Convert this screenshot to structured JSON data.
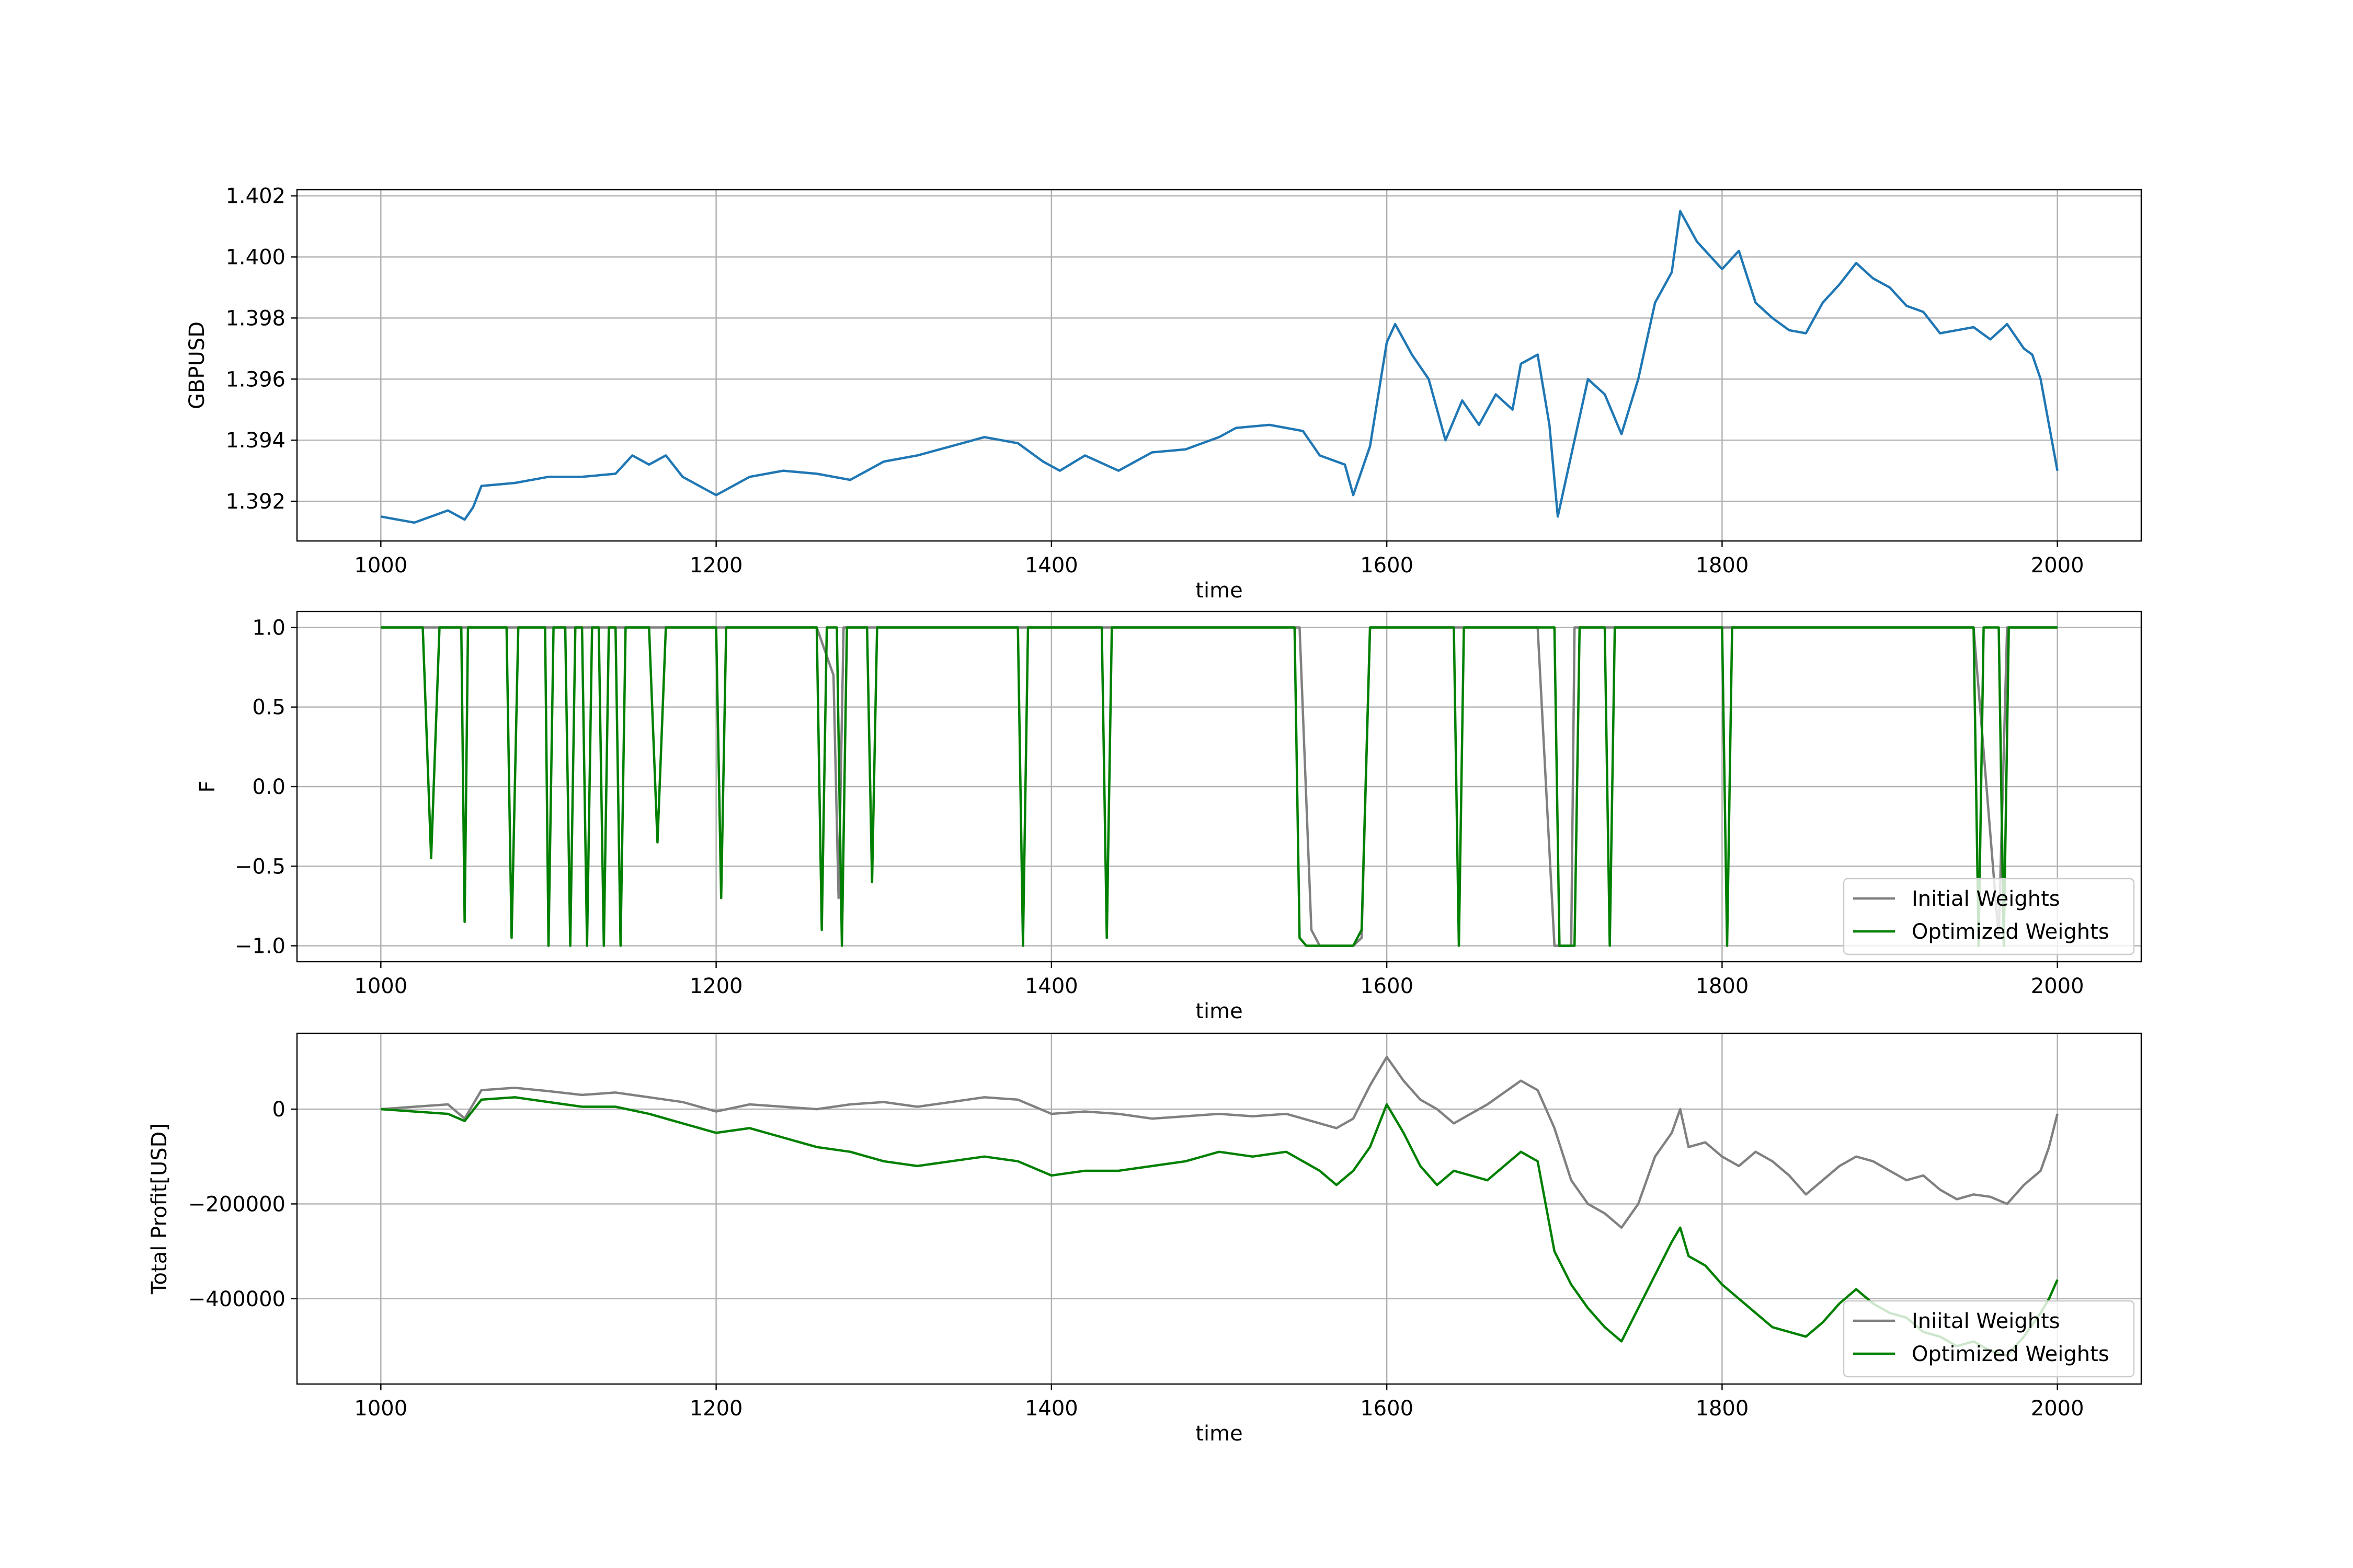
{
  "chart_data": [
    {
      "type": "line",
      "ylabel": "GBPUSD",
      "xlabel": "time",
      "xlim": [
        950,
        2050
      ],
      "ylim": [
        1.3907,
        1.4022
      ],
      "xticks": [
        1000,
        1200,
        1400,
        1600,
        1800,
        2000
      ],
      "xtick_labels": [
        "1000",
        "1200",
        "1400",
        "1600",
        "1800",
        "2000"
      ],
      "yticks": [
        1.392,
        1.394,
        1.396,
        1.398,
        1.4,
        1.402
      ],
      "ytick_labels": [
        "1.392",
        "1.394",
        "1.396",
        "1.398",
        "1.400",
        "1.402"
      ],
      "grid": true,
      "series": [
        {
          "color": "#1f77b4",
          "x": [
            1000,
            1010,
            1020,
            1030,
            1040,
            1050,
            1055,
            1060,
            1080,
            1100,
            1120,
            1140,
            1150,
            1160,
            1170,
            1180,
            1190,
            1200,
            1220,
            1240,
            1260,
            1280,
            1300,
            1320,
            1340,
            1360,
            1380,
            1395,
            1405,
            1420,
            1440,
            1460,
            1480,
            1500,
            1510,
            1530,
            1550,
            1560,
            1575,
            1580,
            1590,
            1600,
            1605,
            1615,
            1625,
            1635,
            1645,
            1655,
            1665,
            1675,
            1680,
            1690,
            1697,
            1702,
            1710,
            1720,
            1730,
            1740,
            1750,
            1760,
            1770,
            1775,
            1785,
            1800,
            1810,
            1820,
            1830,
            1840,
            1850,
            1860,
            1870,
            1880,
            1890,
            1900,
            1910,
            1920,
            1930,
            1940,
            1950,
            1960,
            1970,
            1980,
            1985,
            1990,
            1995,
            2000
          ],
          "y": [
            1.3915,
            1.3914,
            1.3913,
            1.3915,
            1.3917,
            1.3914,
            1.3918,
            1.3925,
            1.3926,
            1.3928,
            1.3928,
            1.3929,
            1.3935,
            1.3932,
            1.3935,
            1.3928,
            1.3925,
            1.3922,
            1.3928,
            1.393,
            1.3929,
            1.3927,
            1.3933,
            1.3935,
            1.3938,
            1.3941,
            1.3939,
            1.3933,
            1.393,
            1.3935,
            1.393,
            1.3936,
            1.3937,
            1.3941,
            1.3944,
            1.3945,
            1.3943,
            1.3935,
            1.3932,
            1.3922,
            1.3938,
            1.3972,
            1.3978,
            1.3968,
            1.396,
            1.394,
            1.3953,
            1.3945,
            1.3955,
            1.395,
            1.3965,
            1.3968,
            1.3945,
            1.3915,
            1.3935,
            1.396,
            1.3955,
            1.3942,
            1.396,
            1.3985,
            1.3995,
            1.4015,
            1.4005,
            1.3996,
            1.4002,
            1.3985,
            1.398,
            1.3976,
            1.3975,
            1.3985,
            1.3991,
            1.3998,
            1.3993,
            1.399,
            1.3984,
            1.3982,
            1.3975,
            1.3976,
            1.3977,
            1.3973,
            1.3978,
            1.397,
            1.3968,
            1.396,
            1.3945,
            1.393
          ]
        }
      ]
    },
    {
      "type": "line",
      "ylabel": "F",
      "xlabel": "time",
      "xlim": [
        950,
        2050
      ],
      "ylim": [
        -1.1,
        1.1
      ],
      "xticks": [
        1000,
        1200,
        1400,
        1600,
        1800,
        2000
      ],
      "xtick_labels": [
        "1000",
        "1200",
        "1400",
        "1600",
        "1800",
        "2000"
      ],
      "yticks": [
        -1.0,
        -0.5,
        0.0,
        0.5,
        1.0
      ],
      "ytick_labels": [
        "−1.0",
        "−0.5",
        "0.0",
        "0.5",
        "1.0"
      ],
      "grid": true,
      "legend_position": "lower right",
      "series": [
        {
          "name": "Initial Weights",
          "color": "#808080",
          "x": [
            1000,
            1020,
            1040,
            1060,
            1080,
            1100,
            1120,
            1140,
            1160,
            1180,
            1200,
            1220,
            1240,
            1260,
            1270,
            1273,
            1276,
            1290,
            1310,
            1330,
            1350,
            1370,
            1390,
            1410,
            1430,
            1450,
            1470,
            1490,
            1510,
            1530,
            1548,
            1555,
            1560,
            1570,
            1580,
            1585,
            1590,
            1610,
            1630,
            1650,
            1670,
            1690,
            1700,
            1705,
            1710,
            1712,
            1720,
            1740,
            1760,
            1780,
            1800,
            1820,
            1850,
            1900,
            1950,
            1965,
            1970,
            2000
          ],
          "y": [
            1.0,
            1.0,
            1.0,
            1.0,
            1.0,
            1.0,
            1.0,
            1.0,
            1.0,
            1.0,
            1.0,
            1.0,
            1.0,
            1.0,
            0.7,
            -0.7,
            1.0,
            1.0,
            1.0,
            1.0,
            1.0,
            1.0,
            1.0,
            1.0,
            1.0,
            1.0,
            1.0,
            1.0,
            1.0,
            1.0,
            1.0,
            -0.9,
            -1.0,
            -1.0,
            -1.0,
            -0.95,
            1.0,
            1.0,
            1.0,
            1.0,
            1.0,
            1.0,
            -1.0,
            -1.0,
            -1.0,
            1.0,
            1.0,
            1.0,
            1.0,
            1.0,
            1.0,
            1.0,
            1.0,
            1.0,
            1.0,
            -0.95,
            1.0,
            1.0
          ]
        },
        {
          "name": "Optimized Weights",
          "color": "#008000",
          "x": [
            1000,
            1025,
            1030,
            1035,
            1048,
            1050,
            1052,
            1075,
            1078,
            1082,
            1098,
            1100,
            1103,
            1110,
            1113,
            1116,
            1120,
            1123,
            1126,
            1130,
            1133,
            1136,
            1140,
            1143,
            1146,
            1160,
            1165,
            1170,
            1200,
            1203,
            1206,
            1260,
            1263,
            1266,
            1272,
            1275,
            1278,
            1290,
            1293,
            1296,
            1380,
            1383,
            1386,
            1430,
            1433,
            1436,
            1545,
            1548,
            1552,
            1560,
            1570,
            1580,
            1585,
            1590,
            1600,
            1640,
            1643,
            1646,
            1700,
            1703,
            1712,
            1715,
            1730,
            1733,
            1736,
            1800,
            1803,
            1806,
            1950,
            1953,
            1956,
            1965,
            1968,
            1971,
            2000
          ],
          "y": [
            1.0,
            1.0,
            -0.45,
            1.0,
            1.0,
            -0.85,
            1.0,
            1.0,
            -0.95,
            1.0,
            1.0,
            -1.0,
            1.0,
            1.0,
            -1.0,
            1.0,
            1.0,
            -1.0,
            1.0,
            1.0,
            -1.0,
            1.0,
            1.0,
            -1.0,
            1.0,
            1.0,
            -0.35,
            1.0,
            1.0,
            -0.7,
            1.0,
            1.0,
            -0.9,
            1.0,
            1.0,
            -1.0,
            1.0,
            1.0,
            -0.6,
            1.0,
            1.0,
            -1.0,
            1.0,
            1.0,
            -0.95,
            1.0,
            1.0,
            -0.95,
            -1.0,
            -1.0,
            -1.0,
            -1.0,
            -0.9,
            1.0,
            1.0,
            1.0,
            -1.0,
            1.0,
            1.0,
            -1.0,
            -1.0,
            1.0,
            1.0,
            -1.0,
            1.0,
            1.0,
            -1.0,
            1.0,
            1.0,
            -1.0,
            1.0,
            1.0,
            -1.0,
            1.0,
            1.0
          ]
        }
      ]
    },
    {
      "type": "line",
      "ylabel": "Total Profit[USD]",
      "xlabel": "time",
      "xlim": [
        950,
        2050
      ],
      "ylim": [
        -580000,
        160000
      ],
      "xticks": [
        1000,
        1200,
        1400,
        1600,
        1800,
        2000
      ],
      "xtick_labels": [
        "1000",
        "1200",
        "1400",
        "1600",
        "1800",
        "2000"
      ],
      "yticks": [
        -400000,
        -200000,
        0
      ],
      "ytick_labels": [
        "−400000",
        "−200000",
        "0"
      ],
      "grid": true,
      "legend_position": "lower right",
      "series": [
        {
          "name": "Iniital Weights",
          "color": "#808080",
          "x": [
            1000,
            1020,
            1040,
            1050,
            1060,
            1080,
            1100,
            1120,
            1140,
            1160,
            1180,
            1200,
            1220,
            1240,
            1260,
            1280,
            1300,
            1320,
            1340,
            1360,
            1380,
            1400,
            1420,
            1440,
            1460,
            1480,
            1500,
            1520,
            1540,
            1560,
            1570,
            1580,
            1590,
            1600,
            1610,
            1620,
            1630,
            1640,
            1660,
            1680,
            1690,
            1700,
            1710,
            1720,
            1730,
            1740,
            1750,
            1760,
            1770,
            1775,
            1780,
            1790,
            1800,
            1810,
            1820,
            1830,
            1840,
            1850,
            1860,
            1870,
            1880,
            1890,
            1900,
            1910,
            1920,
            1930,
            1940,
            1950,
            1960,
            1970,
            1980,
            1990,
            1995,
            2000
          ],
          "y": [
            0,
            5000,
            10000,
            -20000,
            40000,
            45000,
            38000,
            30000,
            35000,
            25000,
            15000,
            -5000,
            10000,
            5000,
            0,
            10000,
            15000,
            5000,
            15000,
            25000,
            20000,
            -10000,
            -5000,
            -10000,
            -20000,
            -15000,
            -10000,
            -15000,
            -10000,
            -30000,
            -40000,
            -20000,
            50000,
            110000,
            60000,
            20000,
            0,
            -30000,
            10000,
            60000,
            40000,
            -40000,
            -150000,
            -200000,
            -220000,
            -250000,
            -200000,
            -100000,
            -50000,
            0,
            -80000,
            -70000,
            -100000,
            -120000,
            -90000,
            -110000,
            -140000,
            -180000,
            -150000,
            -120000,
            -100000,
            -110000,
            -130000,
            -150000,
            -140000,
            -170000,
            -190000,
            -180000,
            -185000,
            -200000,
            -160000,
            -130000,
            -80000,
            -10000
          ]
        },
        {
          "name": "Optimized Weights",
          "color": "#008000",
          "x": [
            1000,
            1020,
            1040,
            1050,
            1060,
            1080,
            1100,
            1120,
            1140,
            1160,
            1180,
            1200,
            1220,
            1240,
            1260,
            1280,
            1300,
            1320,
            1340,
            1360,
            1380,
            1400,
            1420,
            1440,
            1460,
            1480,
            1500,
            1520,
            1540,
            1560,
            1570,
            1580,
            1590,
            1600,
            1610,
            1620,
            1630,
            1640,
            1660,
            1680,
            1690,
            1700,
            1710,
            1720,
            1730,
            1740,
            1750,
            1760,
            1770,
            1775,
            1780,
            1790,
            1800,
            1810,
            1820,
            1830,
            1840,
            1850,
            1860,
            1870,
            1880,
            1890,
            1900,
            1910,
            1920,
            1930,
            1940,
            1950,
            1960,
            1970,
            1980,
            1990,
            1995,
            2000
          ],
          "y": [
            0,
            -5000,
            -10000,
            -25000,
            20000,
            25000,
            15000,
            5000,
            5000,
            -10000,
            -30000,
            -50000,
            -40000,
            -60000,
            -80000,
            -90000,
            -110000,
            -120000,
            -110000,
            -100000,
            -110000,
            -140000,
            -130000,
            -130000,
            -120000,
            -110000,
            -90000,
            -100000,
            -90000,
            -130000,
            -160000,
            -130000,
            -80000,
            10000,
            -50000,
            -120000,
            -160000,
            -130000,
            -150000,
            -90000,
            -110000,
            -300000,
            -370000,
            -420000,
            -460000,
            -490000,
            -420000,
            -350000,
            -280000,
            -250000,
            -310000,
            -330000,
            -370000,
            -400000,
            -430000,
            -460000,
            -470000,
            -480000,
            -450000,
            -410000,
            -380000,
            -410000,
            -430000,
            -440000,
            -470000,
            -480000,
            -500000,
            -490000,
            -510000,
            -520000,
            -480000,
            -430000,
            -400000,
            -360000
          ]
        }
      ]
    }
  ]
}
